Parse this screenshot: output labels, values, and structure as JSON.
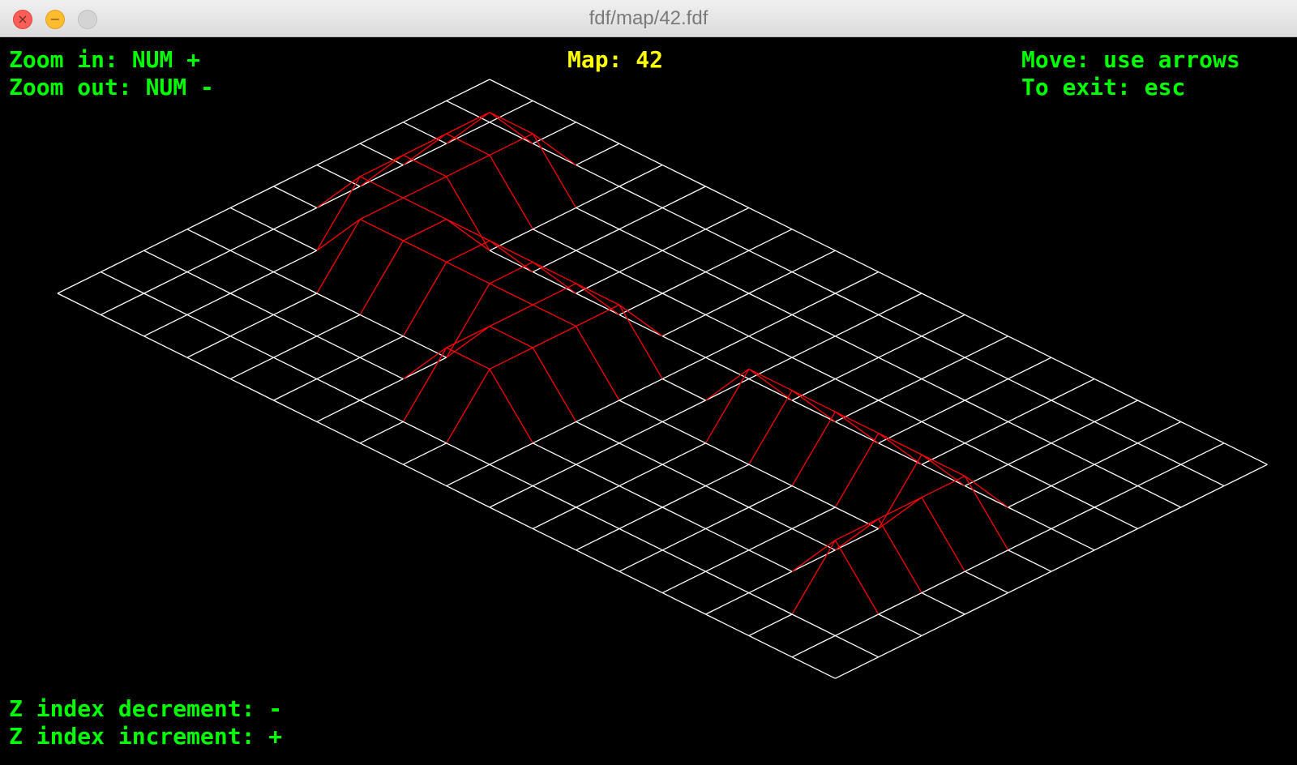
{
  "window": {
    "title": "fdf/map/42.fdf",
    "controls": {
      "close": "×",
      "minimize": "−",
      "maximize": ""
    }
  },
  "hud": {
    "zoom_in": "Zoom in: NUM +",
    "zoom_out": "Zoom out: NUM -",
    "map": "Map: 42",
    "move": "Move: use arrows",
    "exit": "To exit: esc",
    "z_decrement": "Z index decrement: -",
    "z_increment": "Z index increment: +"
  },
  "colors": {
    "background": "#000000",
    "grid_flat": "#ffffff",
    "grid_raised": "#ff0000",
    "controls_text": "#00ff00",
    "map_text": "#ffff00"
  },
  "map": {
    "name": "42",
    "heights": [
      [
        0,
        0,
        0,
        0,
        0,
        0,
        0,
        0,
        0,
        0,
        0,
        0,
        0,
        0,
        0,
        0,
        0,
        0,
        0
      ],
      [
        0,
        0,
        0,
        0,
        0,
        0,
        0,
        0,
        0,
        0,
        0,
        0,
        0,
        0,
        0,
        0,
        0,
        0,
        0
      ],
      [
        0,
        0,
        10,
        10,
        0,
        0,
        0,
        0,
        0,
        0,
        0,
        0,
        0,
        0,
        0,
        0,
        0,
        0,
        0
      ],
      [
        0,
        0,
        10,
        10,
        0,
        0,
        0,
        0,
        0,
        0,
        0,
        0,
        0,
        0,
        0,
        0,
        0,
        0,
        0
      ],
      [
        0,
        0,
        10,
        10,
        0,
        0,
        0,
        0,
        0,
        0,
        0,
        0,
        0,
        0,
        0,
        0,
        0,
        0,
        0
      ],
      [
        0,
        0,
        10,
        10,
        10,
        10,
        10,
        10,
        10,
        0,
        0,
        10,
        10,
        10,
        10,
        10,
        10,
        0,
        0
      ],
      [
        0,
        0,
        0,
        10,
        10,
        10,
        10,
        10,
        10,
        0,
        0,
        0,
        0,
        0,
        0,
        0,
        10,
        0,
        0
      ],
      [
        0,
        0,
        0,
        0,
        0,
        0,
        0,
        10,
        10,
        0,
        0,
        0,
        0,
        0,
        0,
        0,
        10,
        0,
        0
      ],
      [
        0,
        0,
        0,
        0,
        0,
        0,
        0,
        10,
        10,
        0,
        0,
        0,
        0,
        0,
        0,
        0,
        10,
        0,
        0
      ],
      [
        0,
        0,
        0,
        0,
        0,
        0,
        0,
        0,
        0,
        0,
        0,
        0,
        0,
        0,
        0,
        0,
        0,
        0,
        0
      ],
      [
        0,
        0,
        0,
        0,
        0,
        0,
        0,
        0,
        0,
        0,
        0,
        0,
        0,
        0,
        0,
        0,
        0,
        0,
        0
      ]
    ]
  }
}
